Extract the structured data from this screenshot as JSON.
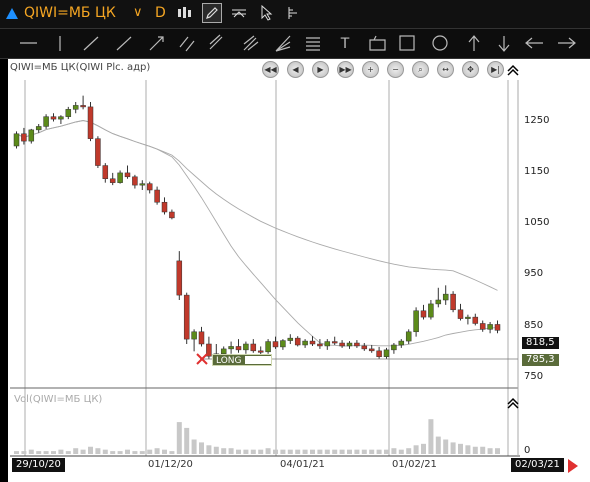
{
  "header": {
    "symbol": "QIWI=МБ ЦК",
    "timeframe": "D"
  },
  "toolbar_icons": [
    "line-h-icon",
    "line-v-icon",
    "trend-line-icon",
    "ray-icon",
    "arrow-line-icon",
    "parallel-lines-icon",
    "linear-regression-icon",
    "fork-icon",
    "speed-lines-icon",
    "fib-levels-icon",
    "text-icon",
    "callout-icon",
    "rectangle-icon",
    "ellipse-icon",
    "arrow-up-icon",
    "arrow-down-icon",
    "arrow-left-icon",
    "arrow-right-icon"
  ],
  "text_tool_glyph": "T",
  "chart": {
    "title": "QIWI=МБ ЦК(QIWI Plc. адр)",
    "volume_title": "Vol(QIWI=МБ ЦК)",
    "y_ticks": [
      "1250",
      "1150",
      "1050",
      "950",
      "850",
      "750"
    ],
    "volume_tick": "0",
    "last_price": "818,5",
    "ma_price": "785,3",
    "order_label": "LONG",
    "x_labels": [
      "29/10/20",
      "01/12/20",
      "04/01/21",
      "01/02/21",
      "02/03/21"
    ],
    "colors": {
      "up": "#5c8a1a",
      "down": "#c0392b",
      "ma": "#999999",
      "volume": "#c8c8c8"
    }
  },
  "chart_data": {
    "type": "candlestick",
    "ylim": [
      700,
      1330
    ],
    "candles": [
      [
        1195,
        1225,
        1190,
        1220
      ],
      [
        1220,
        1232,
        1198,
        1205
      ],
      [
        1205,
        1230,
        1200,
        1228
      ],
      [
        1228,
        1240,
        1222,
        1235
      ],
      [
        1235,
        1260,
        1230,
        1255
      ],
      [
        1255,
        1262,
        1245,
        1250
      ],
      [
        1250,
        1258,
        1240,
        1255
      ],
      [
        1255,
        1275,
        1250,
        1270
      ],
      [
        1270,
        1285,
        1262,
        1278
      ],
      [
        1278,
        1298,
        1270,
        1275
      ],
      [
        1275,
        1285,
        1205,
        1210
      ],
      [
        1210,
        1215,
        1150,
        1155
      ],
      [
        1155,
        1160,
        1120,
        1128
      ],
      [
        1128,
        1140,
        1115,
        1120
      ],
      [
        1120,
        1145,
        1118,
        1140
      ],
      [
        1140,
        1155,
        1128,
        1132
      ],
      [
        1132,
        1136,
        1108,
        1115
      ],
      [
        1115,
        1125,
        1105,
        1118
      ],
      [
        1118,
        1122,
        1098,
        1105
      ],
      [
        1105,
        1112,
        1075,
        1080
      ],
      [
        1080,
        1090,
        1055,
        1060
      ],
      [
        1060,
        1065,
        1045,
        1048
      ],
      [
        960,
        980,
        880,
        890
      ],
      [
        890,
        895,
        790,
        800
      ],
      [
        800,
        820,
        775,
        815
      ],
      [
        815,
        825,
        785,
        790
      ],
      [
        790,
        805,
        760,
        765
      ],
      [
        765,
        790,
        755,
        770
      ],
      [
        770,
        785,
        755,
        780
      ],
      [
        780,
        795,
        770,
        785
      ],
      [
        785,
        800,
        772,
        778
      ],
      [
        778,
        795,
        770,
        790
      ],
      [
        790,
        800,
        772,
        776
      ],
      [
        776,
        785,
        768,
        774
      ],
      [
        774,
        800,
        770,
        795
      ],
      [
        795,
        805,
        780,
        784
      ],
      [
        784,
        800,
        778,
        797
      ],
      [
        797,
        810,
        790,
        802
      ],
      [
        802,
        806,
        785,
        788
      ],
      [
        788,
        800,
        782,
        796
      ],
      [
        796,
        806,
        786,
        790
      ],
      [
        790,
        800,
        780,
        786
      ],
      [
        786,
        800,
        778,
        795
      ],
      [
        795,
        805,
        788,
        792
      ],
      [
        792,
        798,
        782,
        786
      ],
      [
        786,
        796,
        780,
        792
      ],
      [
        792,
        798,
        782,
        786
      ],
      [
        786,
        792,
        776,
        780
      ],
      [
        780,
        788,
        772,
        776
      ],
      [
        776,
        784,
        760,
        764
      ],
      [
        764,
        782,
        760,
        778
      ],
      [
        778,
        792,
        770,
        788
      ],
      [
        788,
        800,
        782,
        796
      ],
      [
        796,
        820,
        790,
        815
      ],
      [
        815,
        865,
        805,
        858
      ],
      [
        858,
        870,
        840,
        845
      ],
      [
        845,
        880,
        840,
        872
      ],
      [
        872,
        905,
        865,
        880
      ],
      [
        880,
        910,
        870,
        892
      ],
      [
        892,
        898,
        855,
        860
      ],
      [
        860,
        872,
        838,
        842
      ],
      [
        842,
        850,
        830,
        845
      ],
      [
        845,
        852,
        828,
        832
      ],
      [
        832,
        838,
        815,
        820
      ],
      [
        820,
        835,
        812,
        830
      ],
      [
        830,
        838,
        812,
        818
      ]
    ],
    "volume": [
      2,
      2,
      3,
      2,
      2,
      2,
      3,
      2,
      4,
      3,
      5,
      4,
      3,
      2,
      2,
      3,
      2,
      2,
      3,
      4,
      3,
      2,
      22,
      18,
      10,
      8,
      6,
      5,
      4,
      4,
      3,
      3,
      3,
      3,
      4,
      3,
      3,
      3,
      3,
      3,
      3,
      3,
      3,
      3,
      3,
      3,
      3,
      3,
      3,
      3,
      3,
      4,
      3,
      4,
      6,
      7,
      24,
      12,
      10,
      8,
      7,
      6,
      5,
      5,
      4,
      4
    ]
  }
}
